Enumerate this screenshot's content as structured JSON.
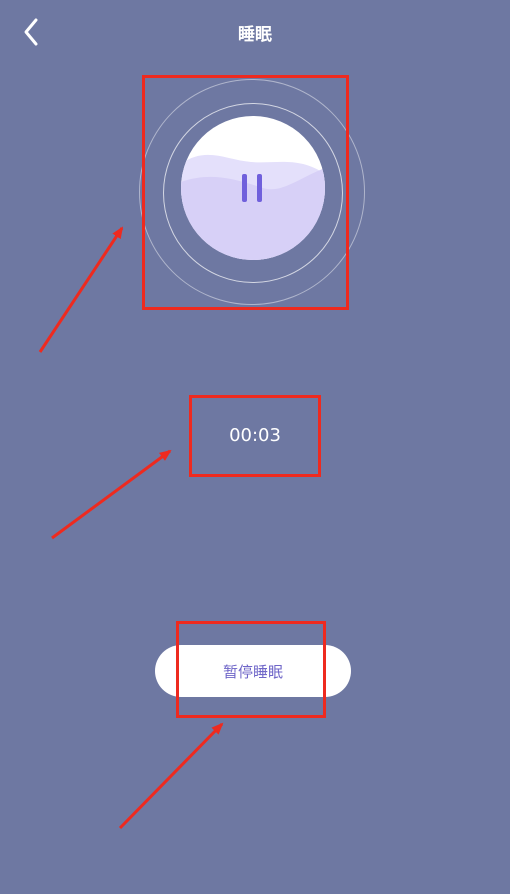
{
  "header": {
    "title": "睡眠",
    "back_icon": "chevron-left-icon"
  },
  "player": {
    "state_icon": "pause-icon",
    "colors": {
      "disc": "#ffffff",
      "wave_back": "#e4e0fb",
      "wave_front": "#d7d0f7",
      "pause": "#7060dc"
    }
  },
  "timer": {
    "elapsed": "00:03"
  },
  "actions": {
    "pause_sleep_label": "暂停睡眠"
  },
  "theme": {
    "background": "#6e78a2",
    "annotation": "#ee2a1f"
  }
}
